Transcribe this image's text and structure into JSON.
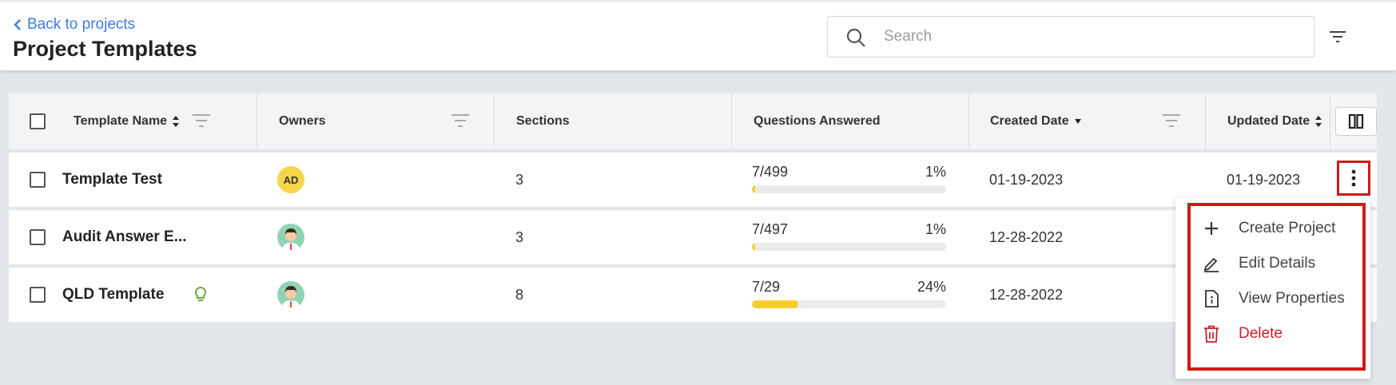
{
  "header": {
    "back_label": "Back to projects",
    "title": "Project Templates",
    "search_placeholder": "Search"
  },
  "columns": {
    "template_name": "Template Name",
    "owners": "Owners",
    "sections": "Sections",
    "questions_answered": "Questions Answered",
    "created_date": "Created Date",
    "updated_date": "Updated Date"
  },
  "rows": [
    {
      "name": "Template Test",
      "owner_type": "initials",
      "owner_initials": "AD",
      "sections": "3",
      "answered": "7/499",
      "percent": "1%",
      "progress_fraction": 0.01,
      "created": "01-19-2023",
      "updated": "01-19-2023"
    },
    {
      "name": "Audit Answer E...",
      "owner_type": "person-avatar",
      "sections": "3",
      "answered": "7/497",
      "percent": "1%",
      "progress_fraction": 0.01,
      "created": "12-28-2022"
    },
    {
      "name": "QLD Template",
      "owner_type": "person-avatar",
      "has_lightbulb_icon": true,
      "sections": "8",
      "answered": "7/29",
      "percent": "24%",
      "progress_fraction": 0.24,
      "created": "12-28-2022"
    }
  ],
  "context_menu": {
    "items": [
      {
        "label": "Create Project",
        "icon": "plus-icon"
      },
      {
        "label": "Edit Details",
        "icon": "pencil-icon"
      },
      {
        "label": "View Properties",
        "icon": "info-document-icon"
      },
      {
        "label": "Delete",
        "icon": "trash-icon"
      }
    ]
  },
  "colors": {
    "accent_link": "#3d7de0",
    "progress": "#f7ce2c",
    "highlight_box": "#d11a1a",
    "danger": "#c8202e",
    "lightbulb": "#5a9e2f"
  }
}
